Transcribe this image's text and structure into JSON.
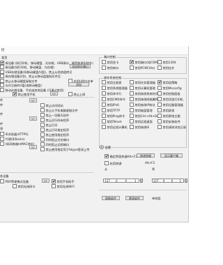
{
  "window": {
    "title": "控"
  },
  "left": {
    "r1": "类型",
    "r2": "接设备 (如打印机、移动硬盘、光存储，USB接口，键盘和鼠标除外)",
    "r3": "接设备(如打印机、移动硬盘、光存储)",
    "r3_button": "添加例外端口",
    "r4": "USB存储设备(如移动硬盘/U盘)，禁止从其他盘拷贝",
    "r5": "接存储设备识别，禁止从移动盘复制文件至",
    "r6": "禁止从移动硬盘复制文件",
    "r6_check": "启用U盘白名单",
    "r7": "允许注册的U盘(或移动硬盘)",
    "r7_button": "添加",
    "r8": "移动存储设备、手机或其他设备 (可通过禁用)",
    "r9_check": "禁止使用手机",
    "r9_button": "+/-",
    "r9_check2": "禁止上网",
    "r10_left": "件",
    "r10_button": "+/-",
    "r11_left": "件",
    "r11_check": "禁止访问网站",
    "r12_check": "禁止从手机电脑复制文件",
    "r13_left": "件",
    "r13_check": "禁止一切聊天软件",
    "r14_button": "+/-",
    "r14_check": "禁止运行所有程序",
    "r15_left": "件",
    "r15_check": "禁止打印",
    "r16_left": "常",
    "r16_check": "禁止打印指定程序",
    "r17_left": "IE浏览器(HTTPS)",
    "r17_check": "禁止使用指定程序",
    "r18_left": "代理(如Socks)",
    "r18_check": "同时阻止对应端口",
    "r19_left": "(如网络端口MAC地址)",
    "r19_check": "同时阻止远程端口",
    "r19_button": "+/-",
    "r20_check": "禁止使用指定用于Skype登录上传",
    "r21": "各设备",
    "r22_left": "PDA等便携式设备",
    "r22_button": "+/-",
    "r22_check": "禁用手机助手",
    "r23_check": "禁用无线网卡",
    "r23_check2": "禁用无线WiFi"
  },
  "right": {
    "port_title": "端口控制",
    "port_items": [
      "禁用显卡",
      "禁用端口(如COM)",
      "禁用1394",
      "禁用串口",
      "禁用PCMCIA口",
      "禁用红外"
    ],
    "sys_title": "操作系统控制",
    "sys_items": [
      "禁用注册表",
      "禁用任务管理器",
      "禁用组策略",
      "禁用系统管理器",
      "禁用计算机管理",
      "禁用Msconfig",
      "禁用命令行",
      "禁用修改系统时间",
      "禁用控制面板",
      "禁用CMD命令",
      "禁用修改网络属性",
      "禁用添加打印机",
      "禁用IPv6",
      "禁用修改IP地址",
      "禁用设备管理器",
      "禁用TFTP",
      "禁用磁盘管理",
      "禁用屏保",
      "禁用Ping命令",
      "禁用Ctrl+Alt+Del",
      "禁用更改主题",
      "禁用Telnet",
      "禁用远程桌面",
      "禁用安装软件",
      "禁用远程计算机",
      "禁用修改IE",
      "禁用清除浏览记录"
    ],
    "radio_label": "设置",
    "hotkey_label": "确定界面热键Alt+F2",
    "hotkey_button": "修改热键",
    "hotkey_button2": "显示客户端",
    "hotkey_check": "启用热键",
    "hotkey_input_label": "Alt+F2",
    "ip_label1": "从",
    "ip_label2": "到",
    "ip_from": [
      "127",
      "0",
      "0",
      "1"
    ],
    "ip_to": [
      "127",
      "0",
      "0",
      "1"
    ],
    "bottom_button1": "限制软件",
    "bottom_button2": "更改软件",
    "bottom_label": "单机版"
  }
}
